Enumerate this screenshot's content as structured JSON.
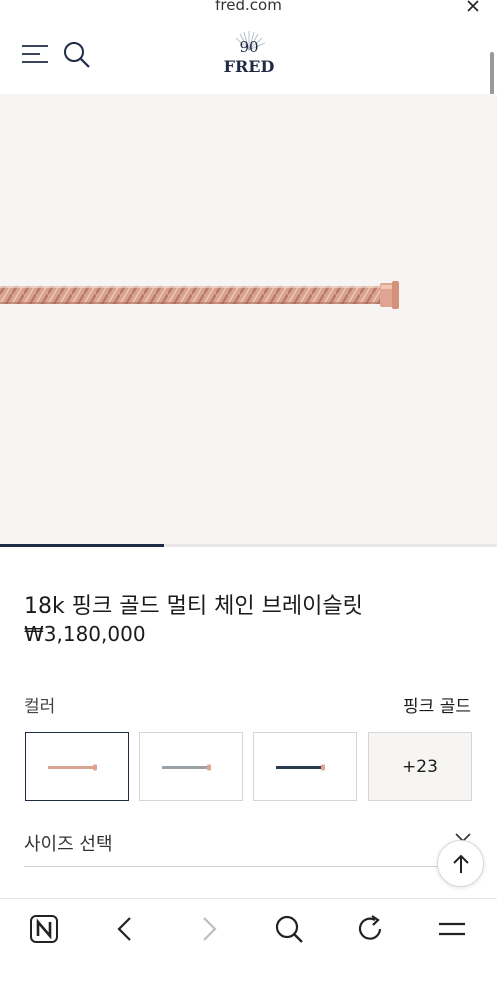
{
  "browser": {
    "url": "fred.com",
    "close_icon": "close-icon"
  },
  "header": {
    "menu_icon": "menu-icon",
    "search_icon": "search-icon",
    "logo_text": "FRED",
    "logo_mark": "90"
  },
  "gallery": {
    "progress": 0.33,
    "image": "rose-gold-multi-chain-bracelet"
  },
  "product": {
    "title": "18k 핑크 골드 멀티 체인 브레이슬릿",
    "price": "₩3,180,000"
  },
  "color": {
    "label": "컬러",
    "selected_value": "핑크 골드",
    "swatches": [
      {
        "name": "pink-gold",
        "cable": "#d9a48f",
        "cap": "#e0a590",
        "selected": true
      },
      {
        "name": "silver-grey",
        "cable": "#9aa2a8",
        "cap": "#e0a590",
        "selected": false
      },
      {
        "name": "navy",
        "cable": "#2a3a4f",
        "cap": "#e0a590",
        "selected": false
      }
    ],
    "more_label": "+23"
  },
  "size": {
    "label": "사이즈 선택"
  },
  "colors": {
    "accent": "#1f2b45",
    "hero_bg": "#f7f5f3",
    "rose_gold": "#d9a48f"
  },
  "bottom_bar": {
    "icons": [
      "naver-home-icon",
      "back-icon",
      "forward-icon",
      "search-icon",
      "reload-icon",
      "menu-icon"
    ]
  }
}
